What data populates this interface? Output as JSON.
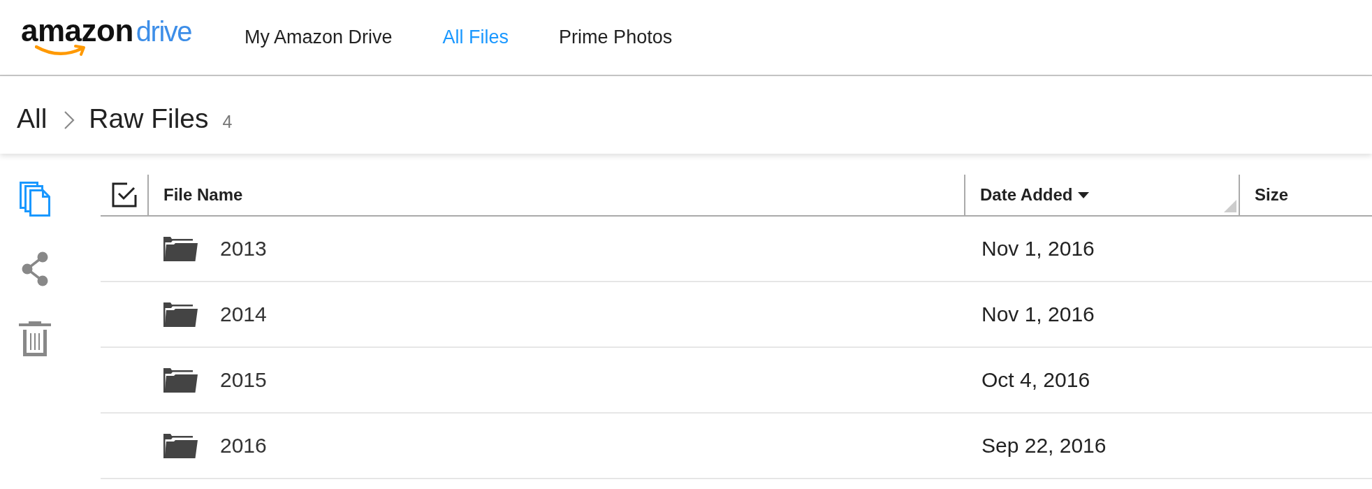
{
  "header": {
    "logo": {
      "brand": "amazon",
      "product": "drive"
    },
    "nav": [
      {
        "label": "My Amazon Drive",
        "selected": false
      },
      {
        "label": "All Files",
        "selected": true
      },
      {
        "label": "Prime Photos",
        "selected": false
      }
    ]
  },
  "breadcrumb": {
    "items": [
      {
        "label": "All"
      },
      {
        "label": "Raw Files"
      }
    ],
    "count": "4"
  },
  "toolbar": [
    {
      "kind": "copy",
      "disabled": false
    },
    {
      "kind": "share",
      "disabled": true
    },
    {
      "kind": "trash",
      "disabled": true
    }
  ],
  "table": {
    "columns": [
      {
        "label": "File Name",
        "sorted": false
      },
      {
        "label": "Date Added",
        "sorted": true,
        "resize_handle": true
      },
      {
        "label": "Size",
        "sorted": false
      }
    ],
    "rows": [
      {
        "kind": "folder",
        "name": "2013",
        "date_added": "Nov 1, 2016"
      },
      {
        "kind": "folder",
        "name": "2014",
        "date_added": "Nov 1, 2016"
      },
      {
        "kind": "folder",
        "name": "2015",
        "date_added": "Oct 4, 2016"
      },
      {
        "kind": "folder",
        "name": "2016",
        "date_added": "Sep 22, 2016"
      }
    ]
  }
}
